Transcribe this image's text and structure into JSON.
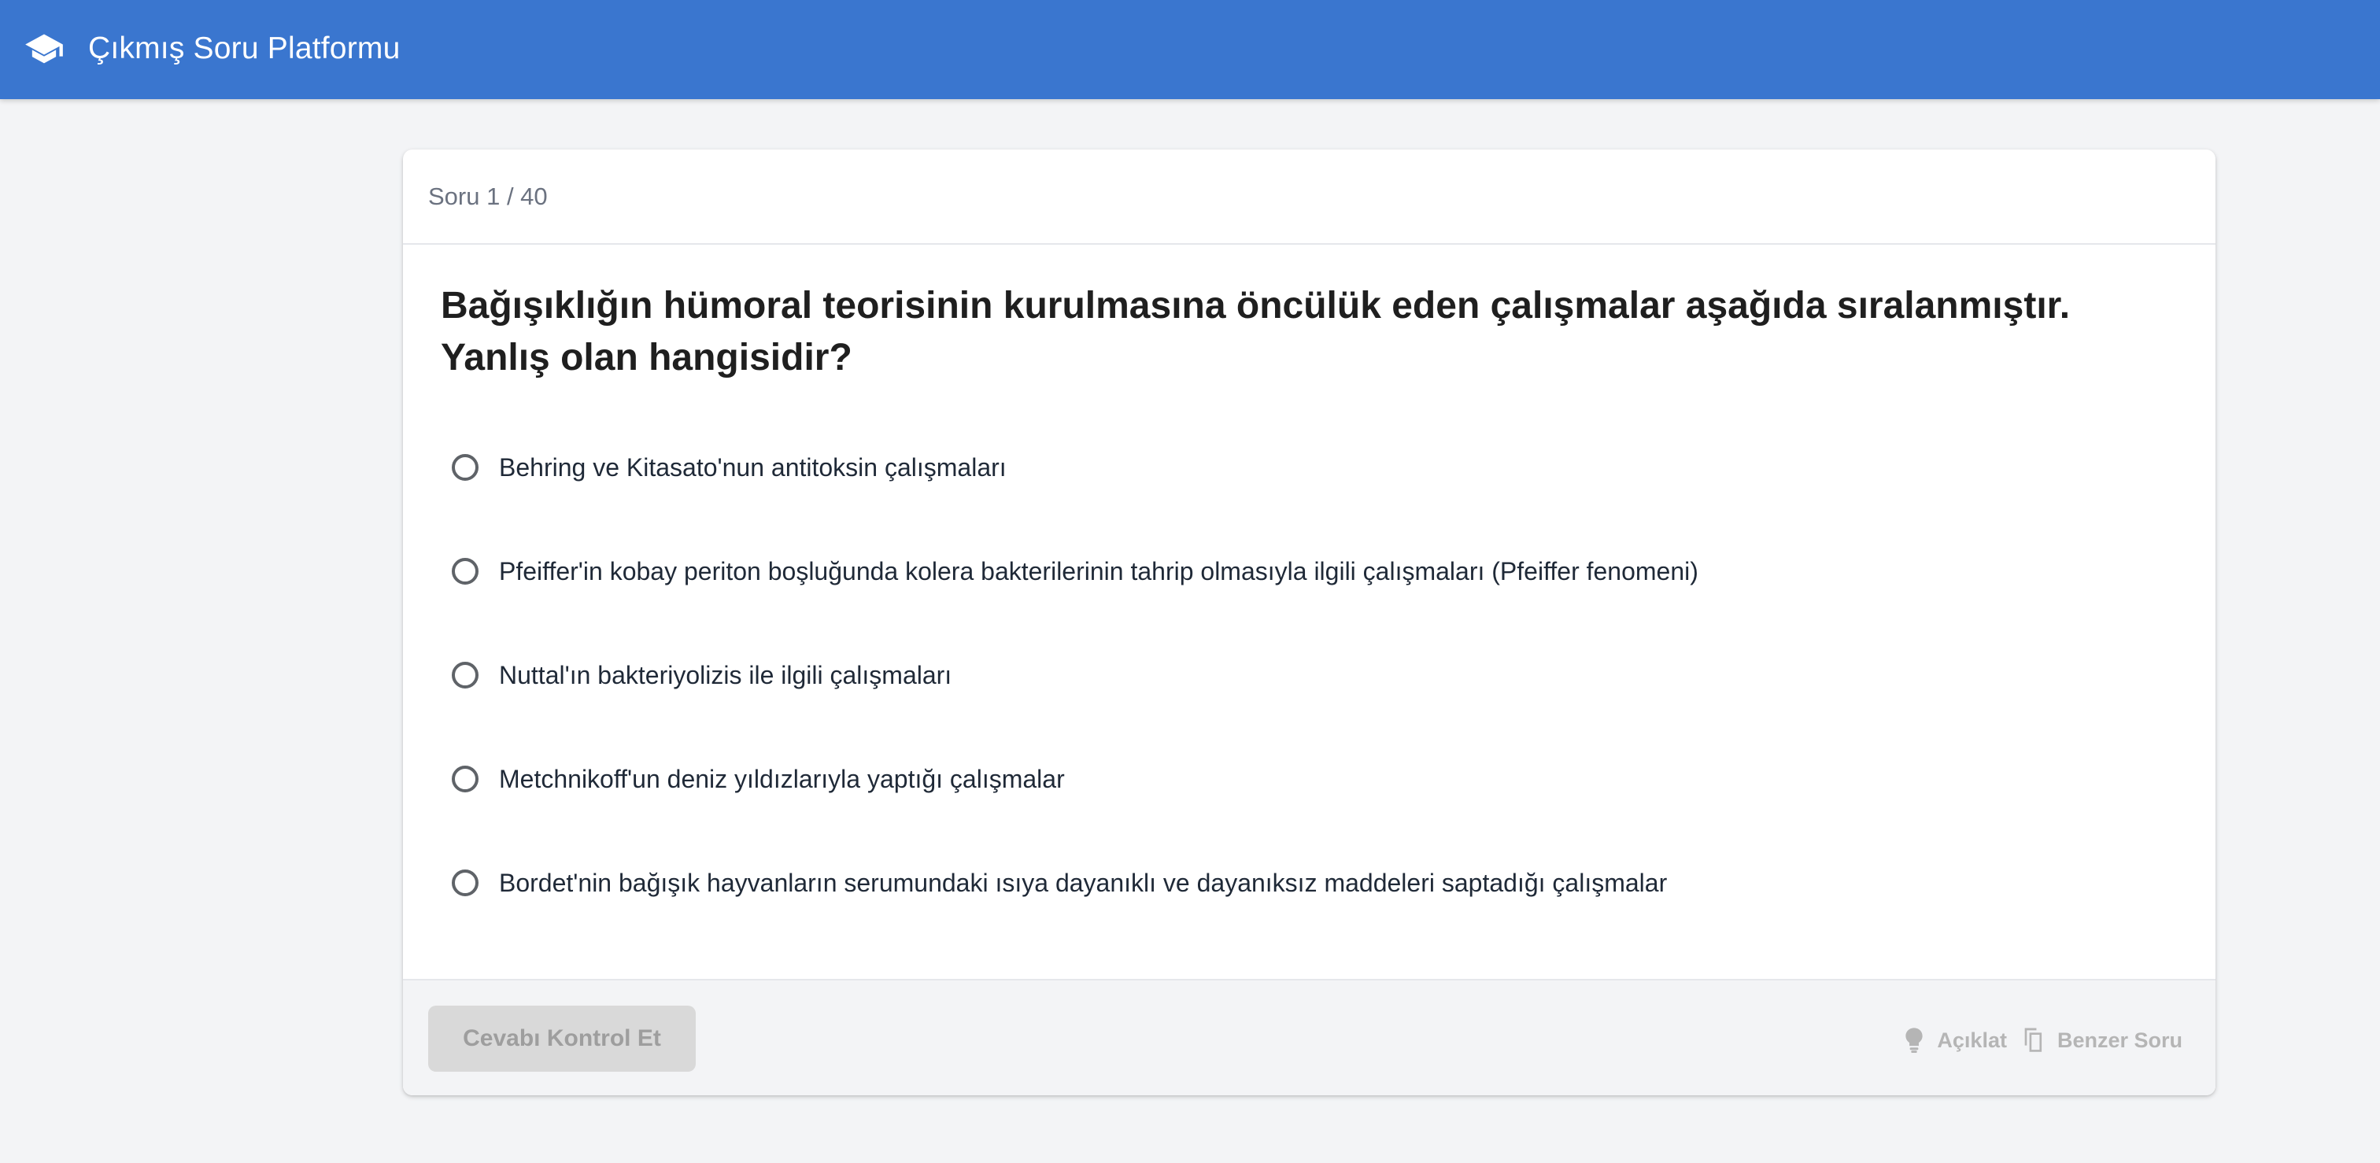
{
  "app": {
    "title": "Çıkmış Soru Platformu",
    "brand_icon": "graduation-cap-icon",
    "accent_color": "#3a76cf"
  },
  "question": {
    "counter": "Soru 1 / 40",
    "text": "Bağışıklığın hümoral teorisinin kurulmasına öncülük eden çalışmalar aşağıda sıralanmıştır. Yanlış olan hangisidir?",
    "options": [
      {
        "label": "Behring ve Kitasato'nun antitoksin çalışmaları",
        "selected": false
      },
      {
        "label": "Pfeiffer'in kobay periton boşluğunda kolera bakterilerinin tahrip olmasıyla ilgili çalışmaları (Pfeiffer fenomeni)",
        "selected": false
      },
      {
        "label": "Nuttal'ın bakteriyolizis ile ilgili çalışmaları",
        "selected": false
      },
      {
        "label": "Metchnikoff'un deniz yıldızlarıyla yaptığı çalışmalar",
        "selected": false
      },
      {
        "label": "Bordet'nin bağışık hayvanların serumundaki ısıya dayanıklı ve dayanıksız maddeleri saptadığı çalışmalar",
        "selected": false
      }
    ]
  },
  "footer": {
    "check_label": "Cevabı Kontrol Et",
    "check_disabled": true,
    "explain": {
      "label": "Açıklat",
      "icon": "lightbulb-icon"
    },
    "similar": {
      "label": "Benzer Soru",
      "icon": "copy-icon"
    }
  }
}
